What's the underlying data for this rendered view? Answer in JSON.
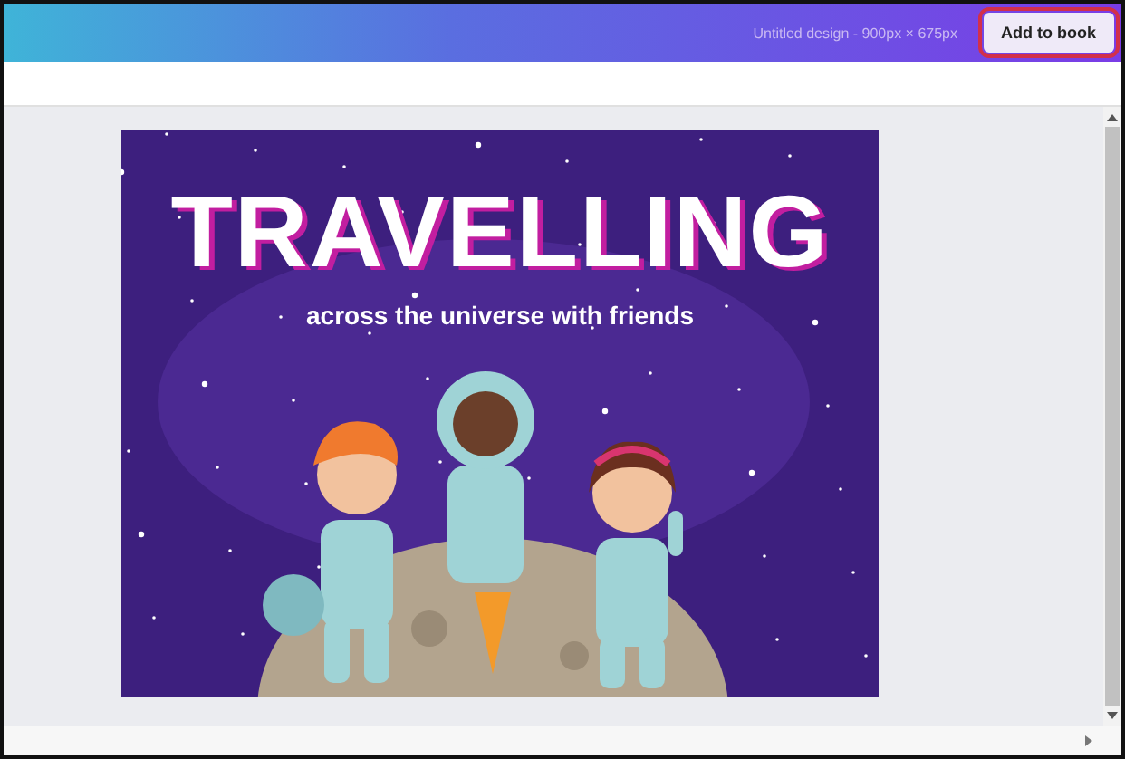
{
  "top_bar": {
    "document_title": "Untitled design - 900px × 675px",
    "action_button": {
      "label": "Add to book",
      "highlighted": true
    }
  },
  "design": {
    "title": "TRAVELLING",
    "subtitle": "across the universe with friends"
  }
}
